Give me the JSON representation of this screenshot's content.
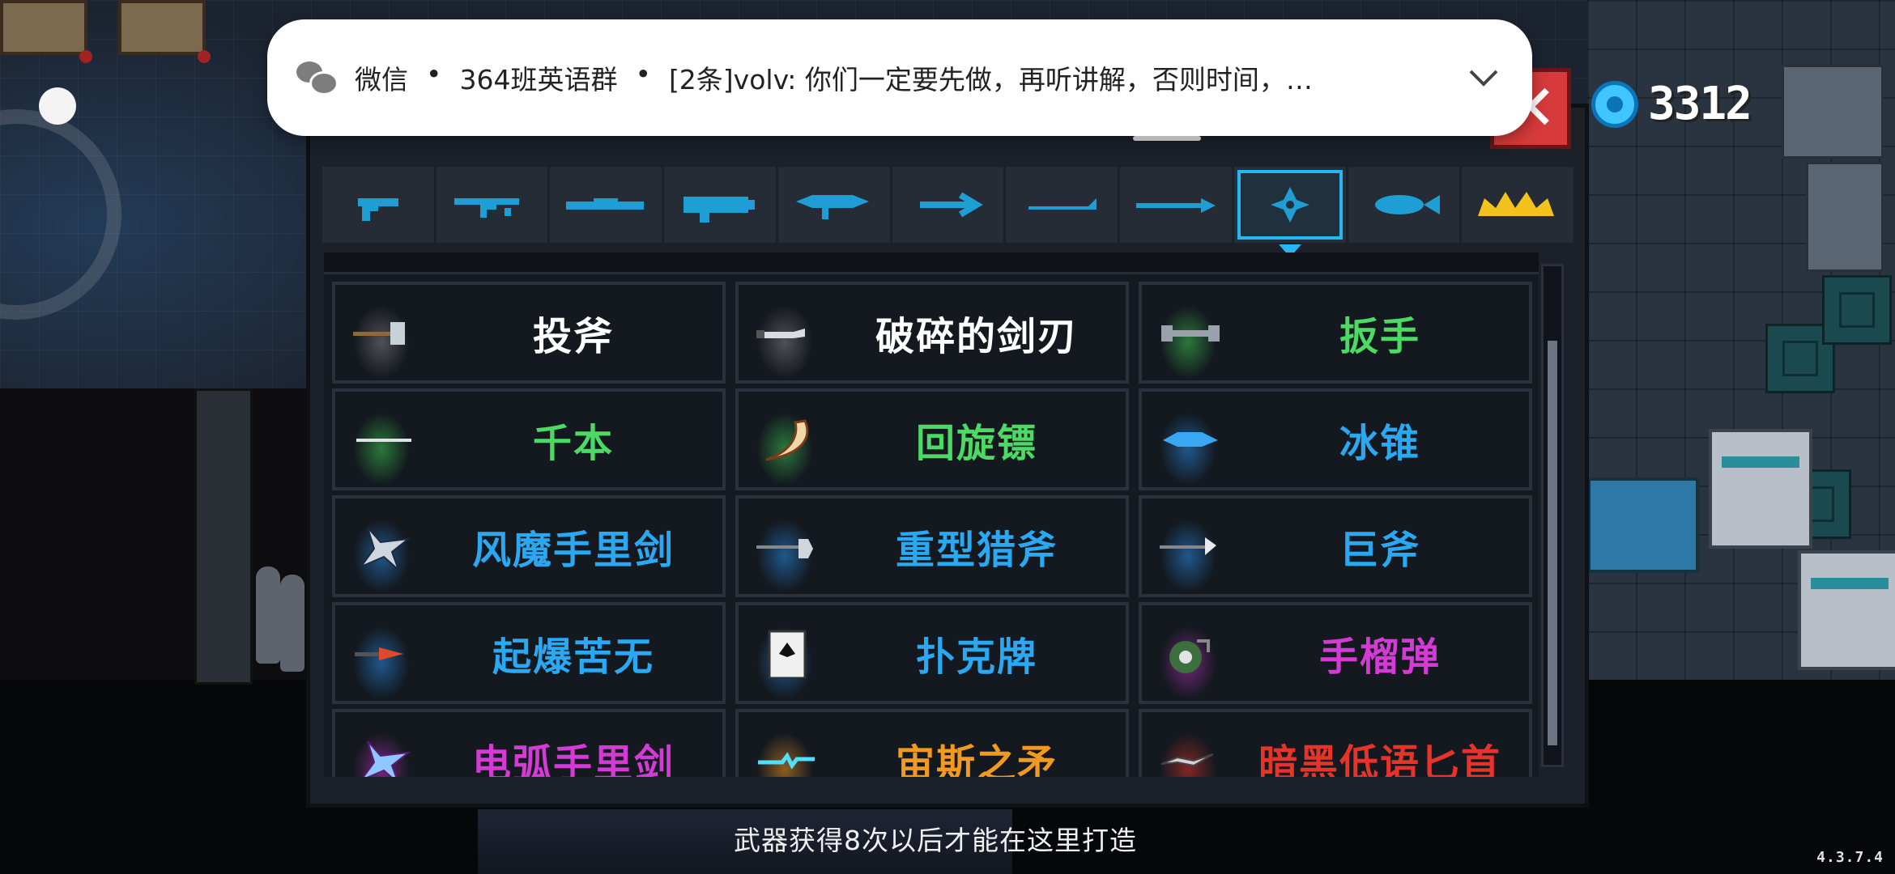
{
  "notification": {
    "app": "微信",
    "group": "364班英语群",
    "message": "[2条]volv: 你们一定要先做，再听讲解，否则时间，…"
  },
  "currency": {
    "gems": "3312"
  },
  "close_glyph": "✕",
  "tabs": [
    {
      "icon": "pistol-icon"
    },
    {
      "icon": "assault-rifle-icon"
    },
    {
      "icon": "shotgun-icon"
    },
    {
      "icon": "laser-cannon-icon"
    },
    {
      "icon": "energy-rifle-icon"
    },
    {
      "icon": "bow-arrow-icon"
    },
    {
      "icon": "blade-icon"
    },
    {
      "icon": "spear-icon"
    },
    {
      "icon": "throwing-star-icon",
      "active": true
    },
    {
      "icon": "fish-icon"
    },
    {
      "icon": "crown-icon"
    }
  ],
  "weapons": [
    {
      "name": "投斧",
      "color": "#ffffff",
      "glow": "rgba(150,150,150,0.45)",
      "icon": "throwing-axe-icon"
    },
    {
      "name": "破碎的剑刃",
      "color": "#ffffff",
      "glow": "rgba(150,150,150,0.45)",
      "icon": "broken-blade-icon"
    },
    {
      "name": "扳手",
      "color": "#4cd964",
      "glow": "rgba(60,200,80,0.55)",
      "icon": "wrench-icon"
    },
    {
      "name": "千本",
      "color": "#4cd964",
      "glow": "rgba(60,200,80,0.55)",
      "icon": "senbon-needle-icon"
    },
    {
      "name": "回旋镖",
      "color": "#4cd964",
      "glow": "rgba(60,200,80,0.55)",
      "icon": "boomerang-icon"
    },
    {
      "name": "冰锥",
      "color": "#2aa8f2",
      "glow": "rgba(40,140,230,0.55)",
      "icon": "ice-cone-icon"
    },
    {
      "name": "风魔手里剑",
      "color": "#2aa8f2",
      "glow": "rgba(40,140,230,0.55)",
      "icon": "fuma-shuriken-icon"
    },
    {
      "name": "重型猎斧",
      "color": "#2aa8f2",
      "glow": "rgba(40,140,230,0.55)",
      "icon": "heavy-hunting-axe-icon"
    },
    {
      "name": "巨斧",
      "color": "#2aa8f2",
      "glow": "rgba(40,140,230,0.55)",
      "icon": "giant-axe-icon"
    },
    {
      "name": "起爆苦无",
      "color": "#2aa8f2",
      "glow": "rgba(40,140,230,0.55)",
      "icon": "explosive-kunai-icon"
    },
    {
      "name": "扑克牌",
      "color": "#2aa8f2",
      "glow": "rgba(40,140,230,0.55)",
      "icon": "poker-card-icon"
    },
    {
      "name": "手榴弹",
      "color": "#d43ad4",
      "glow": "rgba(200,50,200,0.55)",
      "icon": "grenade-icon"
    },
    {
      "name": "电弧手里剑",
      "color": "#d43ad4",
      "glow": "rgba(200,50,200,0.55)",
      "icon": "arc-shuriken-icon"
    },
    {
      "name": "宙斯之矛",
      "color": "#f29a20",
      "glow": "rgba(240,150,30,0.55)",
      "icon": "zeus-spear-icon"
    },
    {
      "name": "暗黑低语匕首",
      "color": "#e8332a",
      "glow": "rgba(220,50,40,0.55)",
      "icon": "dark-whisper-dagger-icon"
    }
  ],
  "hint": "武器获得8次以后才能在这里打造",
  "version": "4.3.7.4"
}
